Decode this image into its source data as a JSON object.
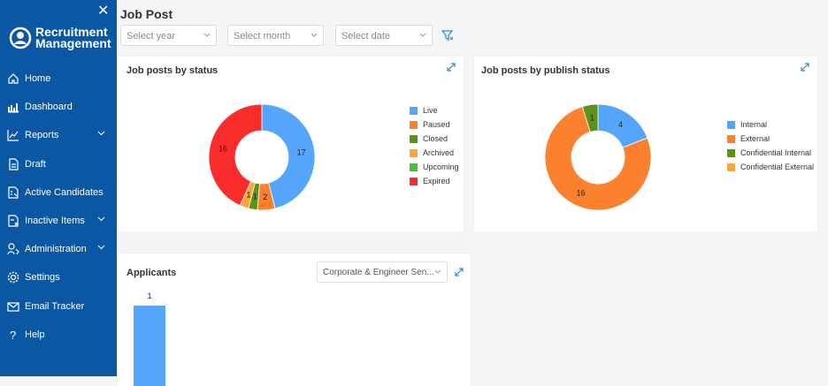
{
  "app": {
    "name_line1": "Recruitment",
    "name_line2": "Management"
  },
  "sidebar": {
    "items": [
      {
        "label": "Home",
        "icon": "home-icon"
      },
      {
        "label": "Dashboard",
        "icon": "dashboard-icon"
      },
      {
        "label": "Reports",
        "icon": "reports-icon",
        "expandable": true
      },
      {
        "label": "Draft",
        "icon": "draft-icon"
      },
      {
        "label": "Active Candidates",
        "icon": "active-candidates-icon"
      },
      {
        "label": "Inactive Items",
        "icon": "inactive-items-icon",
        "expandable": true
      },
      {
        "label": "Administration",
        "icon": "administration-icon",
        "expandable": true
      },
      {
        "label": "Settings",
        "icon": "gear-icon"
      },
      {
        "label": "Email Tracker",
        "icon": "mail-icon"
      },
      {
        "label": "Help",
        "icon": "help-icon"
      }
    ]
  },
  "page": {
    "title": "Job Post"
  },
  "filters": {
    "year_placeholder": "Select year",
    "month_placeholder": "Select month",
    "date_placeholder": "Select date"
  },
  "chart_data": [
    {
      "type": "pie",
      "title": "Job posts by status",
      "donut": true,
      "legend": "right",
      "slices": [
        {
          "label": "Live",
          "value": 17,
          "color": "#55a5fb"
        },
        {
          "label": "Paused",
          "value": 2,
          "color": "#fb812e"
        },
        {
          "label": "Closed",
          "value": 1,
          "color": "#5a9316"
        },
        {
          "label": "Archived",
          "value": 1,
          "color": "#fca735"
        },
        {
          "label": "Upcoming",
          "value": 0,
          "color": "#47c13a"
        },
        {
          "label": "Expired",
          "value": 16,
          "color": "#fb2c2c"
        }
      ]
    },
    {
      "type": "pie",
      "title": "Job posts by publish status",
      "donut": true,
      "legend": "right",
      "slices": [
        {
          "label": "Internal",
          "value": 4,
          "color": "#55a5fb"
        },
        {
          "label": "External",
          "value": 16,
          "color": "#fb812e"
        },
        {
          "label": "Confidential Internal",
          "value": 1,
          "color": "#5a9316"
        },
        {
          "label": "Confidential External",
          "value": 0,
          "color": "#fca735"
        }
      ]
    },
    {
      "type": "bar",
      "title": "Applicants",
      "filter_value": "Corporate & Engineer Sen...",
      "values": [
        1
      ],
      "color": "#55a5fb"
    }
  ]
}
